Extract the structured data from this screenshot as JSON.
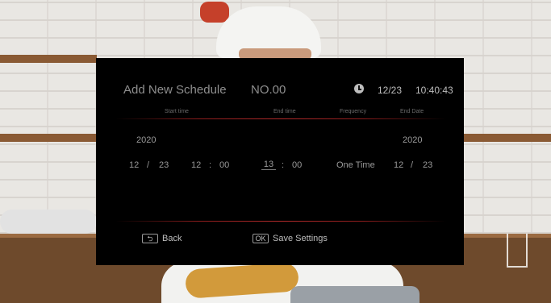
{
  "dialog": {
    "title": "Add New Schedule",
    "schedule_no": "NO.00",
    "date": "12/23",
    "time": "10:40:43"
  },
  "columns": {
    "start_time": "Start time",
    "end_time": "End time",
    "frequency": "Frequency",
    "end_date": "End Date"
  },
  "schedule": {
    "start_year": "2020",
    "start_month": "12",
    "start_day": "23",
    "start_hour": "12",
    "start_min": "00",
    "end_hour": "13",
    "end_min": "00",
    "frequency": "One Time",
    "end_year": "2020",
    "end_month": "12",
    "end_day": "23",
    "date_sep": "/",
    "time_sep": ":"
  },
  "footer": {
    "back_label": "Back",
    "back_key_glyph": "⮌",
    "ok_key": "OK",
    "ok_label": "Save Settings"
  },
  "colors": {
    "panel_bg": "#000000",
    "divider": "#b02a2a",
    "text": "#9a9a9a"
  }
}
